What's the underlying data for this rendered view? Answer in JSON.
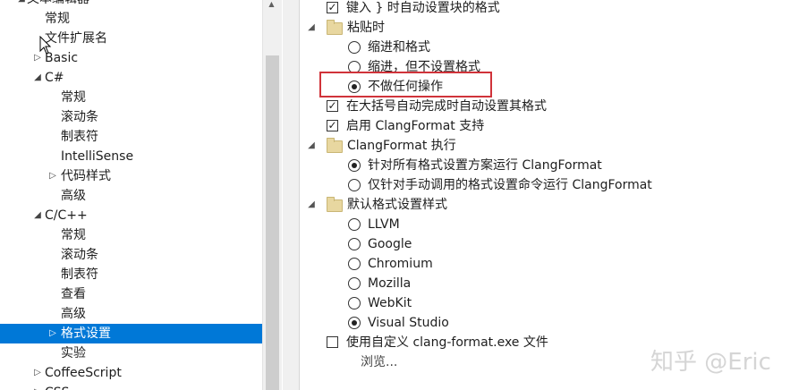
{
  "tree": {
    "items": [
      {
        "label": "文本编辑器",
        "expander": "◢"
      },
      {
        "label": "常规",
        "expander": ""
      },
      {
        "label": "文件扩展名",
        "expander": ""
      },
      {
        "label": "Basic",
        "expander": "▷"
      },
      {
        "label": "C#",
        "expander": "◢"
      },
      {
        "label": "常规",
        "expander": ""
      },
      {
        "label": "滚动条",
        "expander": ""
      },
      {
        "label": "制表符",
        "expander": ""
      },
      {
        "label": "IntelliSense",
        "expander": ""
      },
      {
        "label": "代码样式",
        "expander": "▷"
      },
      {
        "label": "高级",
        "expander": ""
      },
      {
        "label": "C/C++",
        "expander": "◢"
      },
      {
        "label": "常规",
        "expander": ""
      },
      {
        "label": "滚动条",
        "expander": ""
      },
      {
        "label": "制表符",
        "expander": ""
      },
      {
        "label": "查看",
        "expander": ""
      },
      {
        "label": "高级",
        "expander": ""
      },
      {
        "label": "格式设置",
        "expander": "▷"
      },
      {
        "label": "实验",
        "expander": ""
      },
      {
        "label": "CoffeeScript",
        "expander": "▷"
      },
      {
        "label": "CSS",
        "expander": "▷"
      }
    ],
    "selected_label": "格式设置"
  },
  "options": {
    "typing_close_brace": {
      "label": "键入 } 时自动设置块的格式",
      "checked": "✓"
    },
    "paste_group": {
      "label": "粘贴时",
      "expander": "◢"
    },
    "paste_indent_format": {
      "label": "缩进和格式"
    },
    "paste_indent_only": {
      "label": "缩进，但不设置格式"
    },
    "paste_do_nothing": {
      "label": "不做任何操作"
    },
    "format_on_brace_complete": {
      "label": "在大括号自动完成时自动设置其格式",
      "checked": "✓"
    },
    "enable_clangformat": {
      "label": "启用 ClangFormat 支持",
      "checked": "✓"
    },
    "clangformat_exec_group": {
      "label": "ClangFormat 执行",
      "expander": "◢"
    },
    "run_all": {
      "label": "针对所有格式设置方案运行 ClangFormat"
    },
    "run_manual": {
      "label": "仅针对手动调用的格式设置命令运行 ClangFormat"
    },
    "default_style_group": {
      "label": "默认格式设置样式",
      "expander": "◢"
    },
    "styles": [
      "LLVM",
      "Google",
      "Chromium",
      "Mozilla",
      "WebKit",
      "Visual Studio"
    ],
    "selected_style": "Visual Studio",
    "custom_clang_format": {
      "label": "使用自定义 clang-format.exe 文件"
    },
    "browse": {
      "label": "浏览..."
    }
  },
  "watermark": "知乎 @Eric",
  "colors": {
    "selection": "#0078d7",
    "highlight_border": "#d0333a"
  }
}
